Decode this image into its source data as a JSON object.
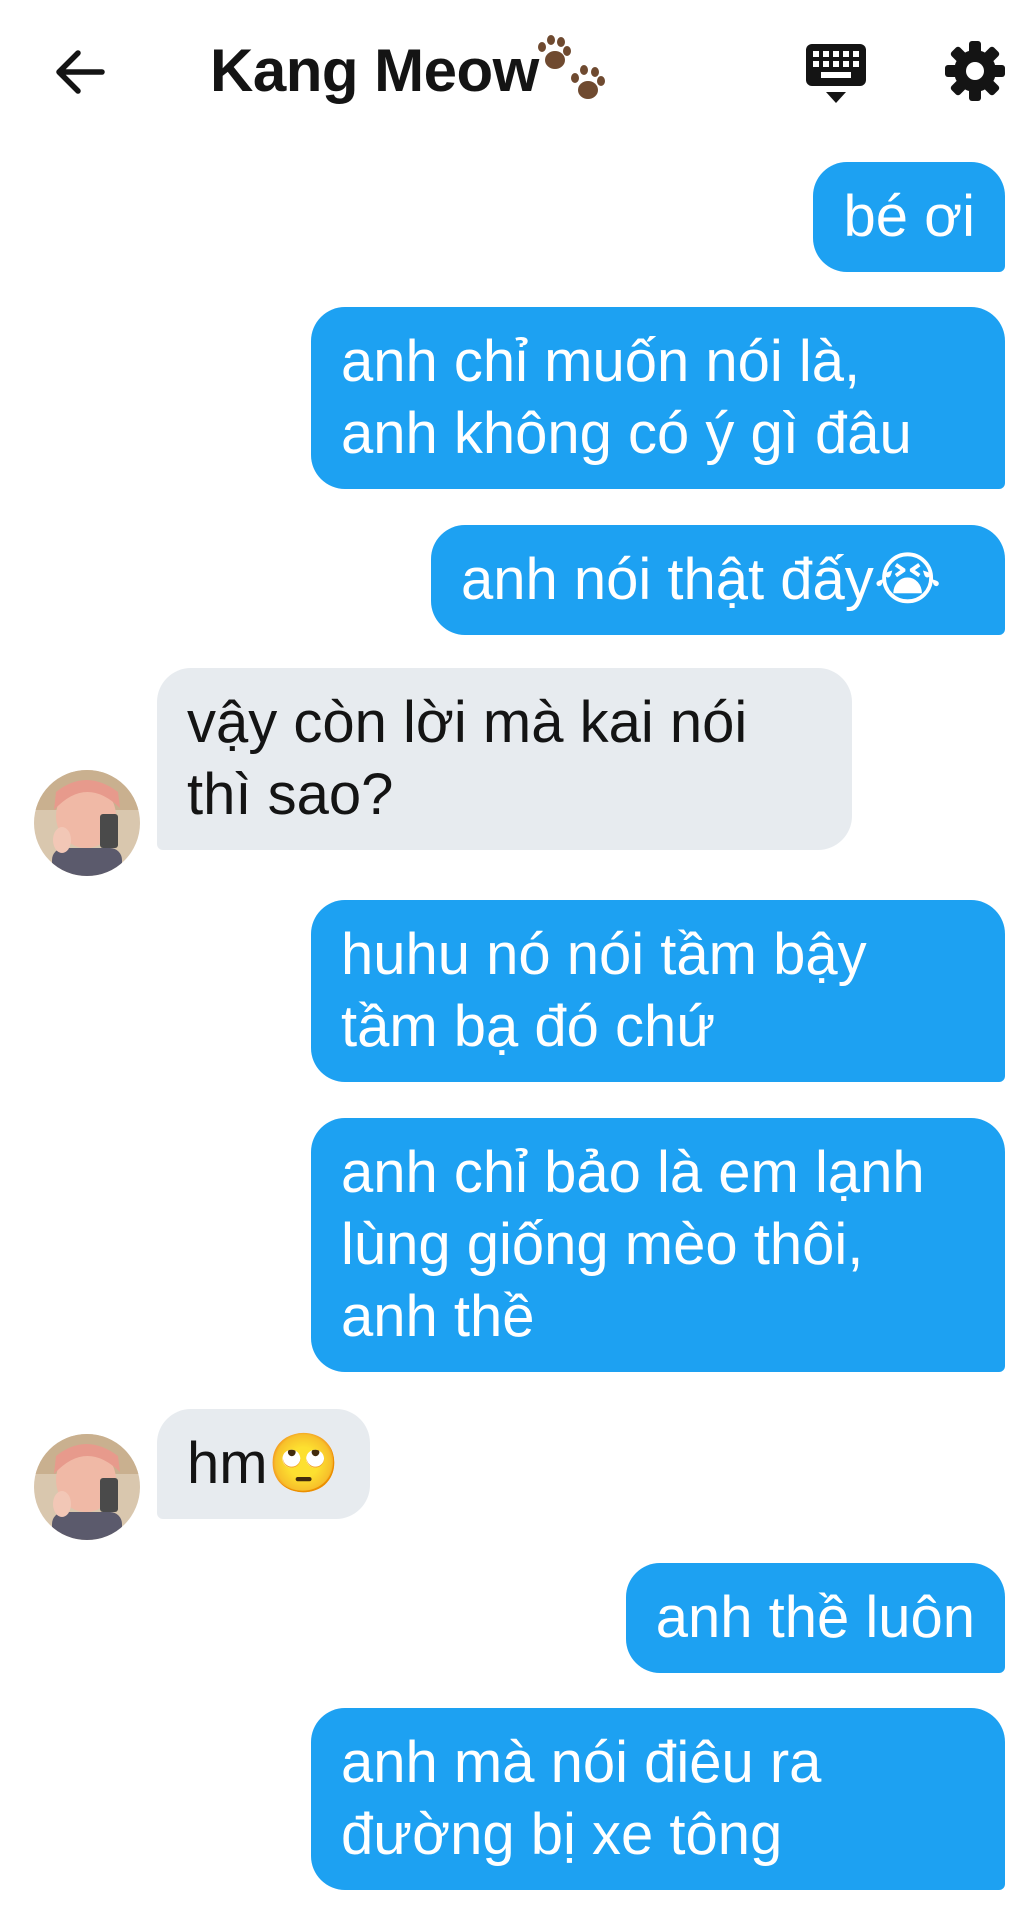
{
  "header": {
    "title": "Kang Meow",
    "title_emoji": "paw-prints-icon",
    "back_icon": "arrow-left-icon",
    "keyboard_icon": "keyboard-icon",
    "settings_icon": "gear-icon"
  },
  "colors": {
    "outgoing_bubble": "#1da1f2",
    "incoming_bubble": "#e7ebef",
    "outgoing_text": "#ffffff",
    "incoming_text": "#141414"
  },
  "messages": [
    {
      "dir": "out",
      "lines": [
        "bé ơi"
      ]
    },
    {
      "dir": "out",
      "lines": [
        "anh chỉ muốn nói là,",
        "anh không có ý gì đâu"
      ]
    },
    {
      "dir": "out",
      "lines": [
        "anh nói thật đấy😭"
      ]
    },
    {
      "dir": "in",
      "lines": [
        "vậy còn lời mà kai nói",
        "thì sao?"
      ]
    },
    {
      "dir": "out",
      "lines": [
        "huhu nó nói tầm bậy",
        "tầm bạ đó chứ"
      ]
    },
    {
      "dir": "out",
      "lines": [
        "anh chỉ bảo là em lạnh",
        "lùng giống mèo thôi,",
        "anh thề"
      ]
    },
    {
      "dir": "in",
      "lines": [
        "hm🙄"
      ]
    },
    {
      "dir": "out",
      "lines": [
        "anh thề luôn"
      ]
    },
    {
      "dir": "out",
      "lines": [
        "anh mà nói điêu ra",
        "đường bị xe tông"
      ]
    }
  ]
}
